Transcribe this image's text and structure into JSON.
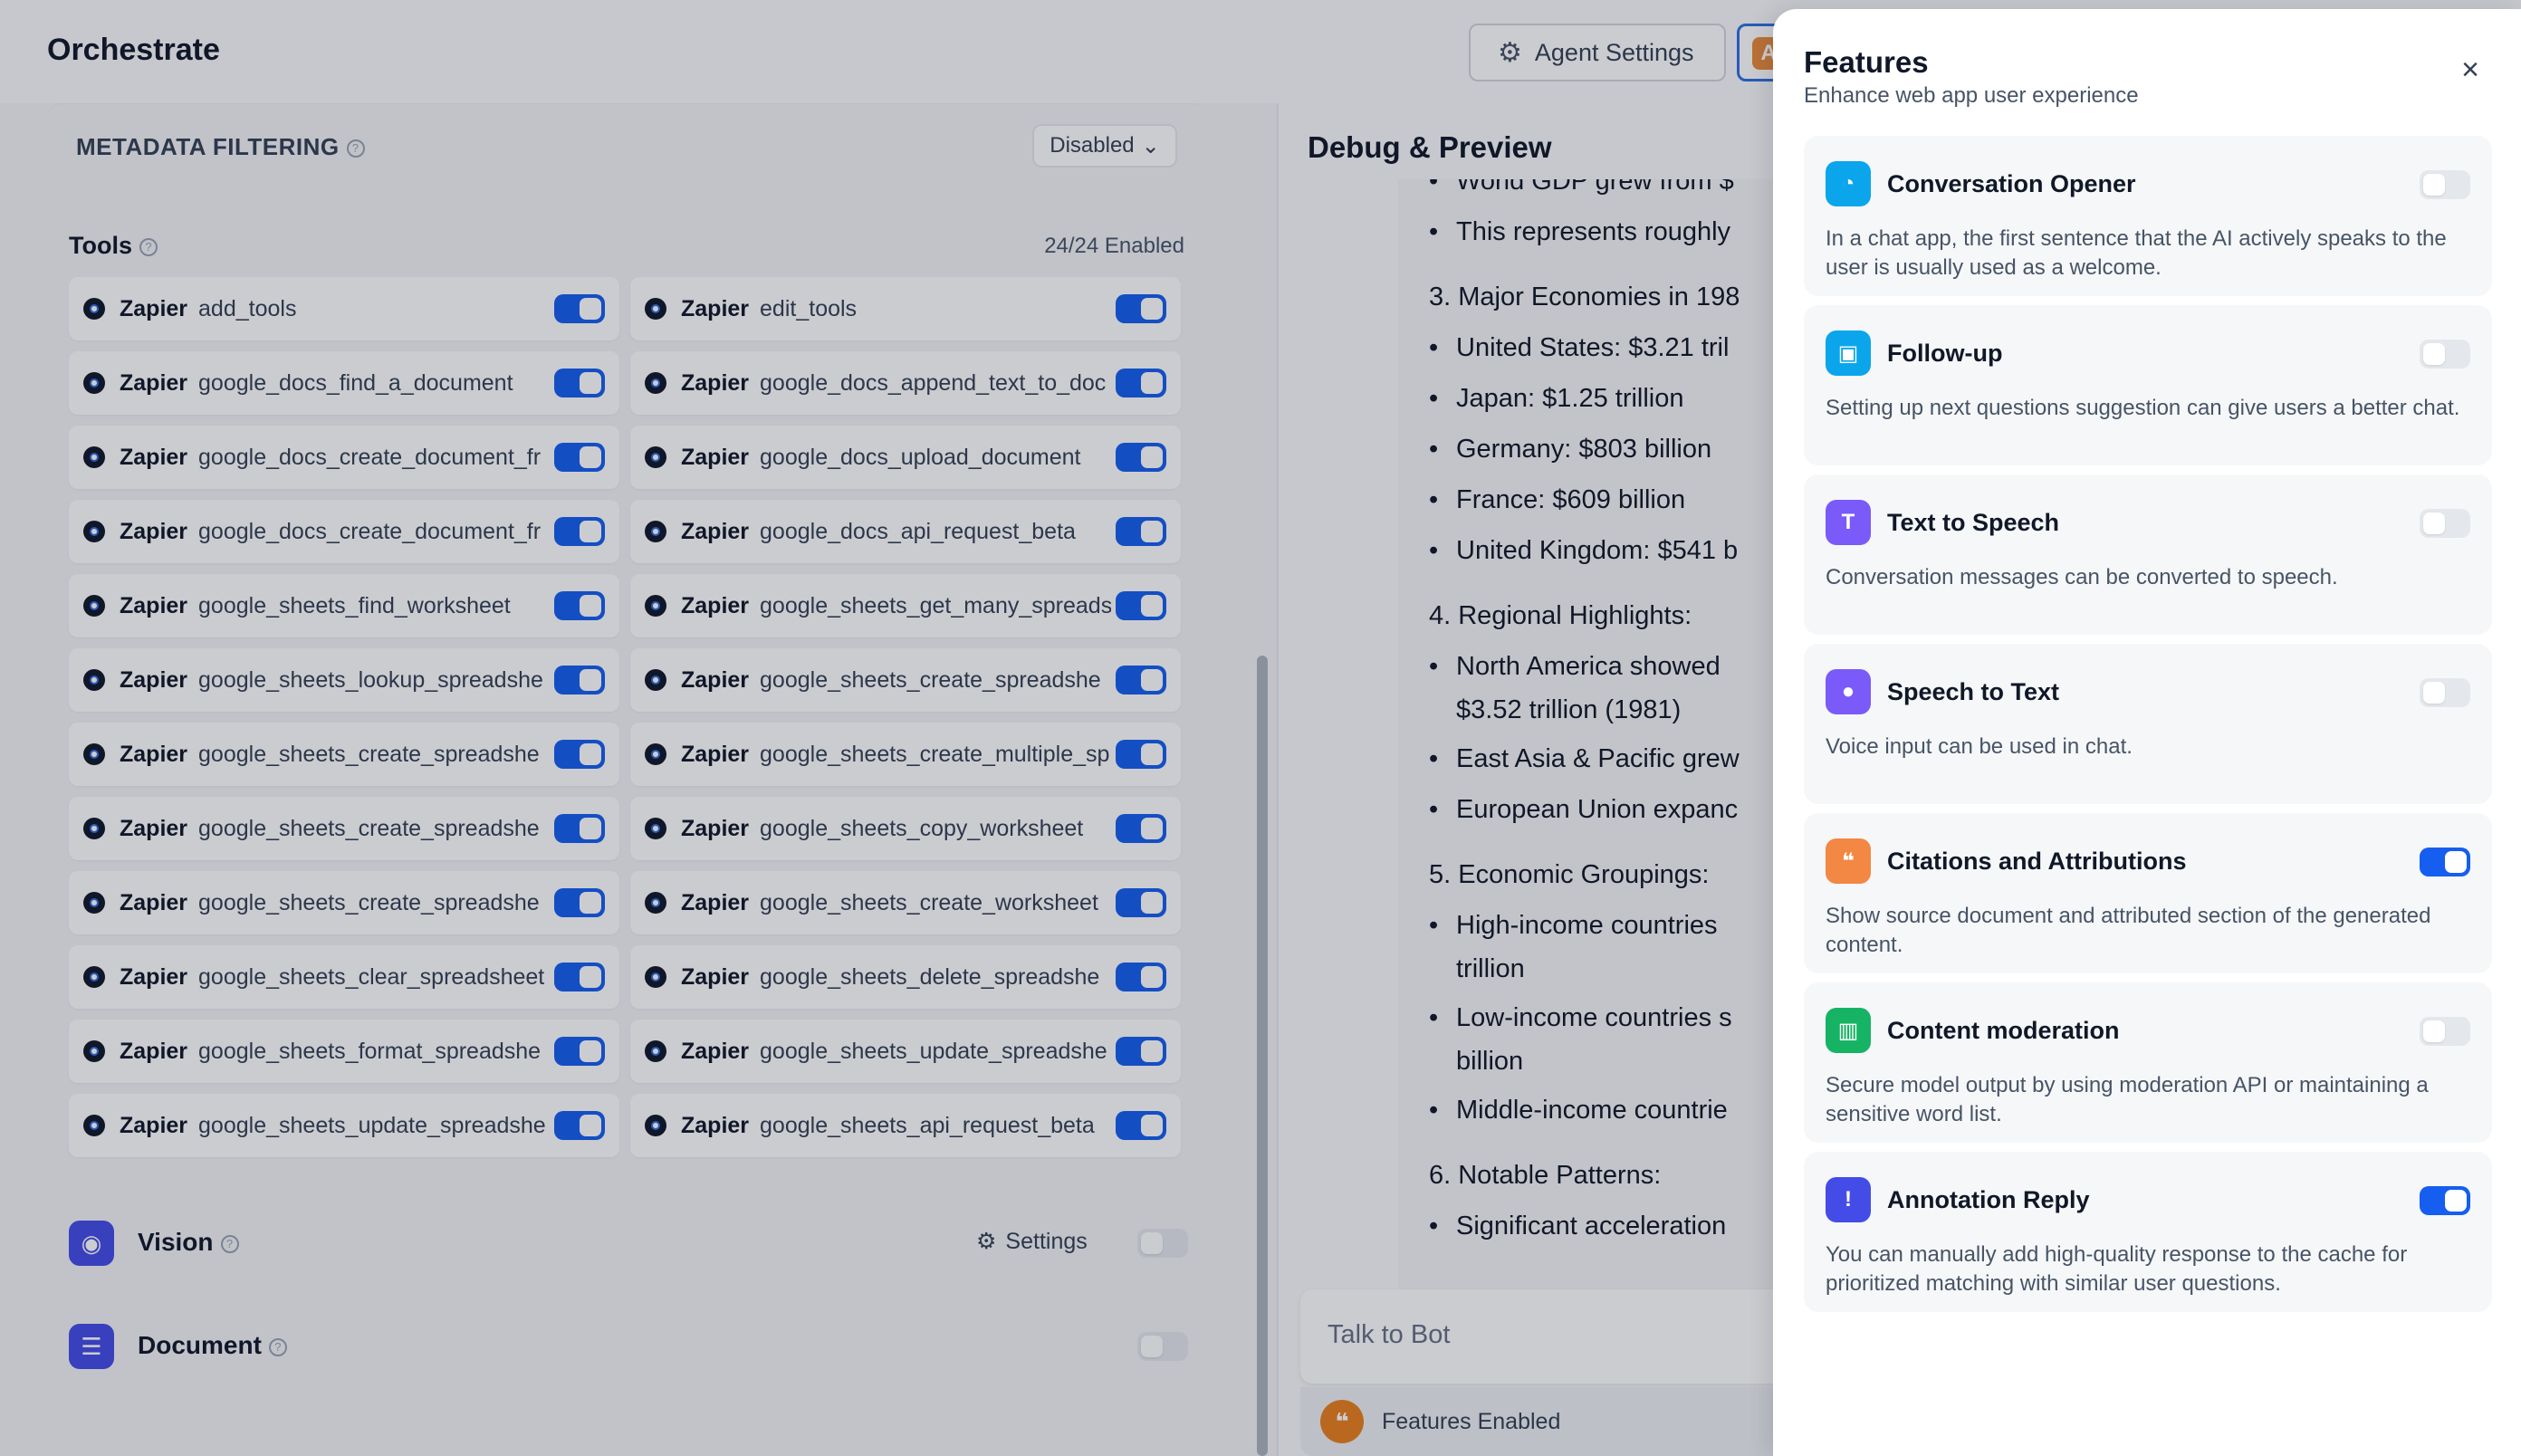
{
  "app": {
    "title": "Orchestrate",
    "agent_settings_label": "Agent Settings",
    "avatar_letter": "A"
  },
  "metadata": {
    "label": "METADATA FILTERING",
    "value": "Disabled"
  },
  "tools": {
    "title": "Tools",
    "count": "24/24 Enabled",
    "provider": "Zapier",
    "items": [
      {
        "name": "add_tools",
        "enabled": true
      },
      {
        "name": "edit_tools",
        "enabled": true
      },
      {
        "name": "google_docs_find_a_document",
        "enabled": true
      },
      {
        "name": "google_docs_append_text_to_doc",
        "enabled": true
      },
      {
        "name": "google_docs_create_document_fr",
        "enabled": true
      },
      {
        "name": "google_docs_upload_document",
        "enabled": true
      },
      {
        "name": "google_docs_create_document_fr",
        "enabled": true
      },
      {
        "name": "google_docs_api_request_beta",
        "enabled": true
      },
      {
        "name": "google_sheets_find_worksheet",
        "enabled": true
      },
      {
        "name": "google_sheets_get_many_spreads",
        "enabled": true
      },
      {
        "name": "google_sheets_lookup_spreadshe",
        "enabled": true
      },
      {
        "name": "google_sheets_create_spreadshe",
        "enabled": true
      },
      {
        "name": "google_sheets_create_spreadshe",
        "enabled": true
      },
      {
        "name": "google_sheets_create_multiple_sp",
        "enabled": true
      },
      {
        "name": "google_sheets_create_spreadshe",
        "enabled": true
      },
      {
        "name": "google_sheets_copy_worksheet",
        "enabled": true
      },
      {
        "name": "google_sheets_create_spreadshe",
        "enabled": true
      },
      {
        "name": "google_sheets_create_worksheet",
        "enabled": true
      },
      {
        "name": "google_sheets_clear_spreadsheet",
        "enabled": true
      },
      {
        "name": "google_sheets_delete_spreadshe",
        "enabled": true
      },
      {
        "name": "google_sheets_format_spreadshe",
        "enabled": true
      },
      {
        "name": "google_sheets_update_spreadshe",
        "enabled": true
      },
      {
        "name": "google_sheets_update_spreadshe",
        "enabled": true
      },
      {
        "name": "google_sheets_api_request_beta",
        "enabled": true
      }
    ]
  },
  "vision": {
    "label": "Vision",
    "settings_label": "Settings",
    "enabled": false
  },
  "document": {
    "label": "Document",
    "enabled": false
  },
  "debug": {
    "title": "Debug & Preview",
    "lines": [
      {
        "type": "bullet",
        "text": "World GDP grew from $"
      },
      {
        "type": "bullet",
        "text": "This represents roughly"
      },
      {
        "type": "num",
        "text": "3. Major Economies in 198"
      },
      {
        "type": "bullet",
        "text": "United States: $3.21 tril"
      },
      {
        "type": "bullet",
        "text": "Japan: $1.25 trillion"
      },
      {
        "type": "bullet",
        "text": "Germany: $803 billion"
      },
      {
        "type": "bullet",
        "text": "France: $609 billion"
      },
      {
        "type": "bullet",
        "text": "United Kingdom: $541 b"
      },
      {
        "type": "num",
        "text": "4. Regional Highlights:"
      },
      {
        "type": "bullet",
        "text": "North America showed"
      },
      {
        "type": "cont",
        "text": "$3.52 trillion (1981)"
      },
      {
        "type": "bullet",
        "text": "East Asia & Pacific grew"
      },
      {
        "type": "bullet",
        "text": "European Union expanc"
      },
      {
        "type": "num",
        "text": "5. Economic Groupings:"
      },
      {
        "type": "bullet",
        "text": "High-income countries"
      },
      {
        "type": "cont",
        "text": "trillion"
      },
      {
        "type": "bullet",
        "text": "Low-income countries s"
      },
      {
        "type": "cont",
        "text": "billion"
      },
      {
        "type": "bullet",
        "text": "Middle-income countrie"
      },
      {
        "type": "num",
        "text": "6. Notable Patterns:"
      },
      {
        "type": "bullet",
        "text": "Significant acceleration"
      }
    ],
    "input_placeholder": "Talk to Bot",
    "features_enabled_label": "Features Enabled"
  },
  "features": {
    "title": "Features",
    "subtitle": "Enhance web app user experience",
    "items": [
      {
        "title": "Conversation Opener",
        "desc": "In a chat app, the first sentence that the AI actively speaks to the user is usually used as a welcome.",
        "enabled": false,
        "color": "#0ba5ec",
        "icon": "chat-bubble-icon"
      },
      {
        "title": "Follow-up",
        "desc": "Setting up next questions suggestion can give users a better chat.",
        "enabled": false,
        "color": "#0ba5ec",
        "icon": "chat-bubbles-icon"
      },
      {
        "title": "Text to Speech",
        "desc": "Conversation messages can be converted to speech.",
        "enabled": false,
        "color": "#7a5af8",
        "icon": "text-speech-icon"
      },
      {
        "title": "Speech to Text",
        "desc": "Voice input can be used in chat.",
        "enabled": false,
        "color": "#7a5af8",
        "icon": "microphone-icon"
      },
      {
        "title": "Citations and Attributions",
        "desc": "Show source document and attributed section of the generated content.",
        "enabled": true,
        "color": "#f38744",
        "icon": "quote-icon"
      },
      {
        "title": "Content moderation",
        "desc": "Secure model output by using moderation API or maintaining a sensitive word list.",
        "enabled": false,
        "color": "#16b364",
        "icon": "shield-chart-icon"
      },
      {
        "title": "Annotation Reply",
        "desc": "You can manually add high-quality response to the cache for prioritized matching with similar user questions.",
        "enabled": true,
        "color": "#444ce7",
        "icon": "message-fast-icon"
      }
    ]
  }
}
